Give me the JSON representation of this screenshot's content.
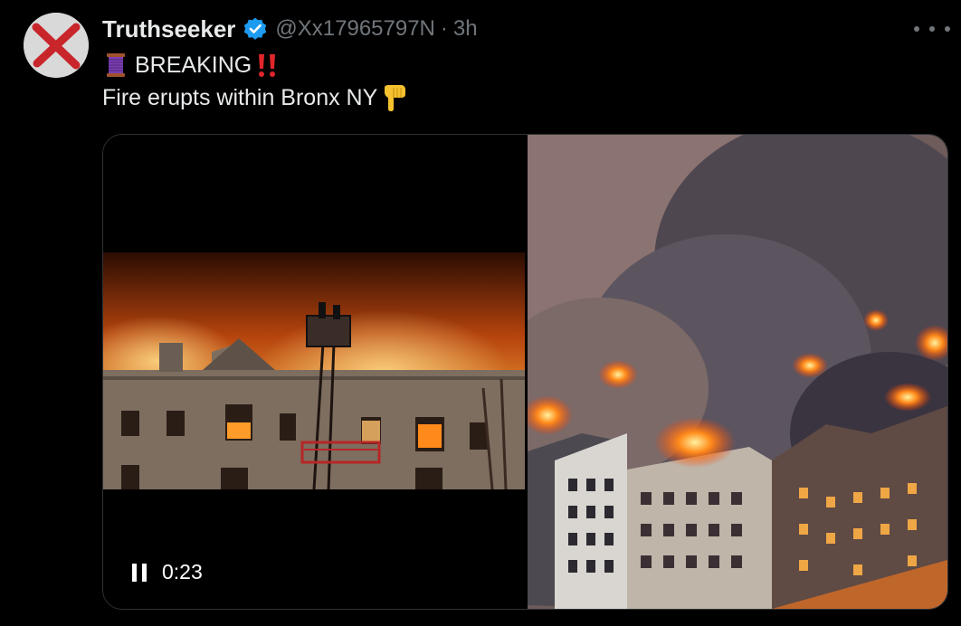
{
  "tweet": {
    "display_name": "Truthseeker",
    "handle": "@Xx17965797N",
    "separator": "·",
    "time": "3h",
    "line1": "BREAKING",
    "line2": "Fire erupts within Bronx NY"
  },
  "icons": {
    "avatar": "red-x-avatar",
    "verified": "verified-badge-icon",
    "more": "more-options-icon",
    "spool": "thread-spool-emoji",
    "exclamation": "double-exclamation-emoji",
    "finger": "pointing-down-emoji",
    "pause": "pause-icon",
    "play": "play-icon"
  },
  "media": {
    "left_video_duration": "0:23"
  },
  "colors": {
    "background": "#000000",
    "text": "#e7e9ea",
    "muted": "#71767b",
    "verified": "#1d9bf0",
    "border": "#2f3336"
  }
}
